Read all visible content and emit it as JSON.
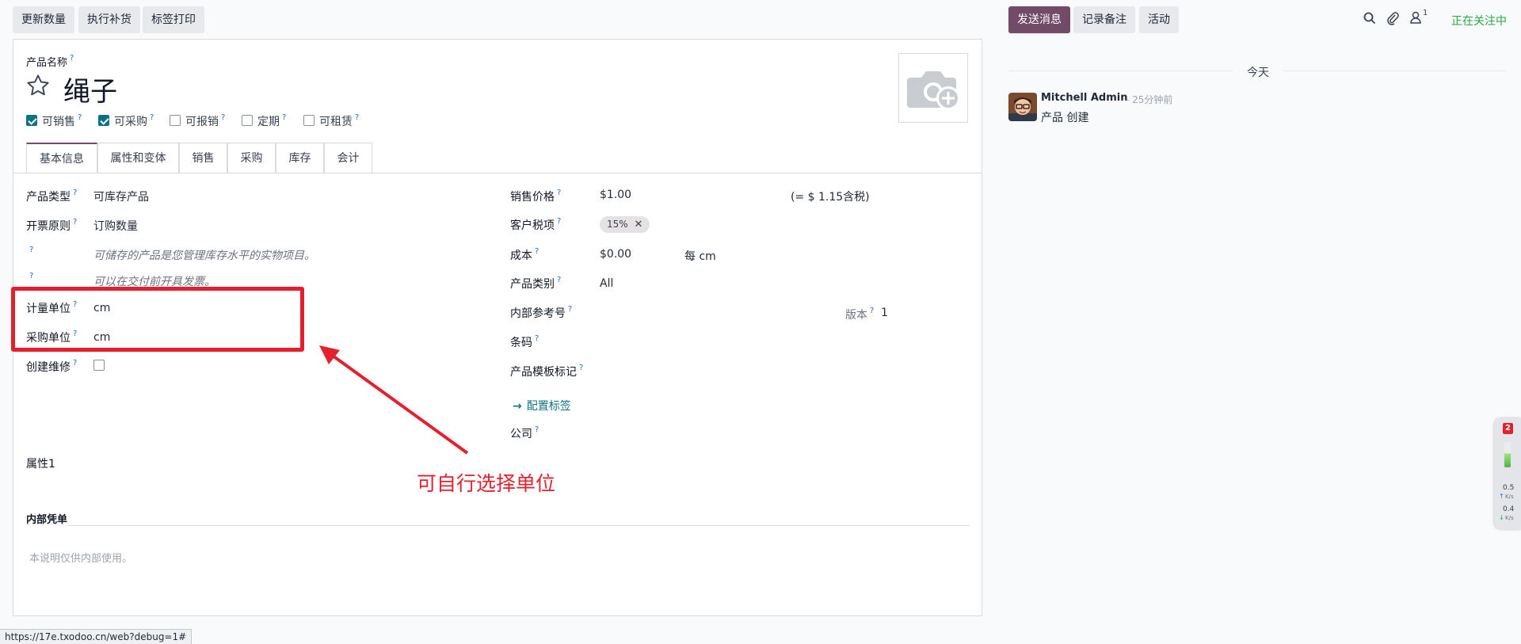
{
  "toolbar": {
    "update_qty": "更新数量",
    "replenish": "执行补货",
    "print_labels": "标签打印"
  },
  "chatter_bar": {
    "send_message": "发送消息",
    "log_note": "记录备注",
    "activity": "活动",
    "attachment_count": "1",
    "following": "正在关注中"
  },
  "product": {
    "name_label": "产品名称",
    "name": "绳子",
    "checkboxes": [
      {
        "label": "可销售",
        "checked": true
      },
      {
        "label": "可采购",
        "checked": true
      },
      {
        "label": "可报销",
        "checked": false
      },
      {
        "label": "定期",
        "checked": false
      },
      {
        "label": "可租赁",
        "checked": false
      }
    ]
  },
  "tabs": [
    "基本信息",
    "属性和变体",
    "销售",
    "采购",
    "库存",
    "会计"
  ],
  "left_fields": {
    "product_type_label": "产品类型",
    "product_type": "可库存产品",
    "invoice_policy_label": "开票原则",
    "invoice_policy": "订购数量",
    "hint1": "可储存的产品是您管理库存水平的实物项目。",
    "hint2": "可以在交付前开具发票。",
    "uom_label": "计量单位",
    "uom": "cm",
    "purchase_uom_label": "采购单位",
    "purchase_uom": "cm",
    "create_repair_label": "创建维修",
    "attribute_label": "属性1",
    "internal_notes_label": "内部凭单",
    "internal_notes_placeholder": "本说明仅供内部使用。"
  },
  "right_fields": {
    "sale_price_label": "销售价格",
    "sale_price": "$1.00",
    "tax_included": "(= $ 1.15含税)",
    "customer_tax_label": "客户税项",
    "customer_tax_tag": "15%",
    "cost_label": "成本",
    "cost": "$0.00",
    "cost_unit": "每 cm",
    "category_label": "产品类别",
    "category": "All",
    "internal_ref_label": "内部参考号",
    "version_label": "版本",
    "version": "1",
    "barcode_label": "条码",
    "template_tags_label": "产品模板标记",
    "configure_tags": "配置标签",
    "company_label": "公司"
  },
  "chatter": {
    "date_separator": "今天",
    "author": "Mitchell Admin",
    "time": "- 25分钟前",
    "message": "产品 创建"
  },
  "annotation": {
    "text": "可自行选择单位",
    "color": "#e5202e"
  },
  "status_url": "https://17e.txodoo.cn/web?debug=1#",
  "widget": {
    "badge": "2",
    "up_value": "0.5",
    "up_unit": "K/s",
    "down_value": "0.4",
    "down_unit": "K/s"
  },
  "colors": {
    "primary": "#714b67",
    "teal": "#0e7285",
    "following": "#28a745"
  }
}
